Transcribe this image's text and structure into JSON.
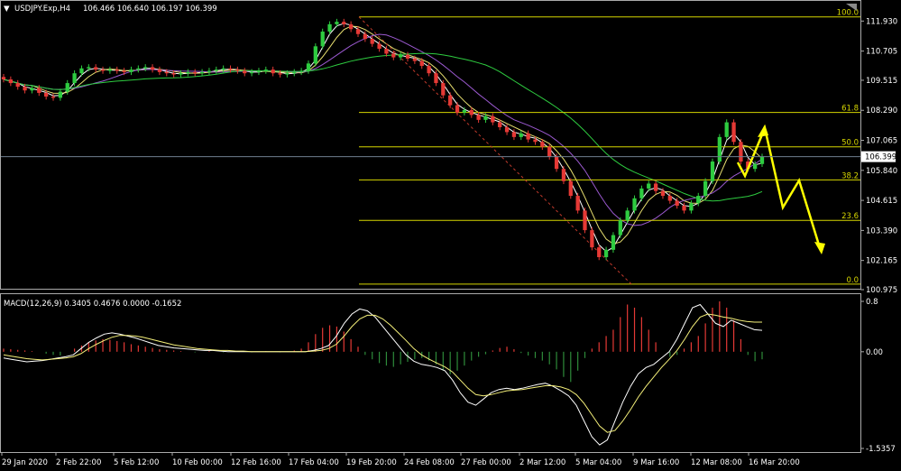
{
  "chart_data": [
    {
      "type": "candlestick",
      "title": "USDJPY.Exp,H4",
      "ohlc": "106.466 106.640 106.197 106.399",
      "current_price": "106.399",
      "y_ticks": [
        "111.930",
        "110.705",
        "109.515",
        "108.290",
        "107.065",
        "105.840",
        "104.615",
        "103.390",
        "102.165",
        "100.975"
      ],
      "ylim": [
        100.975,
        112.2
      ],
      "x_labels": [
        "29 Jan 2020",
        "2 Feb 22:00",
        "5 Feb 12:00",
        "10 Feb 00:00",
        "12 Feb 16:00",
        "17 Feb 04:00",
        "19 Feb 20:00",
        "24 Feb 08:00",
        "27 Feb 00:00",
        "2 Mar 12:00",
        "5 Mar 04:00",
        "9 Mar 16:00",
        "12 Mar 08:00",
        "16 Mar 20:00"
      ],
      "fibonacci": [
        {
          "label": "100.0",
          "value": 112.1
        },
        {
          "label": "61.8",
          "value": 108.2
        },
        {
          "label": "50.0",
          "value": 106.8
        },
        {
          "label": "38.2",
          "value": 105.45
        },
        {
          "label": "23.6",
          "value": 103.8
        },
        {
          "label": "0.0",
          "value": 101.2
        }
      ],
      "closes": [
        109.55,
        109.4,
        109.25,
        109.1,
        109.2,
        109.0,
        108.85,
        108.8,
        109.05,
        109.4,
        109.8,
        110.0,
        110.05,
        109.95,
        109.9,
        109.95,
        109.9,
        109.85,
        109.95,
        110.0,
        110.05,
        109.95,
        109.85,
        109.8,
        109.75,
        109.8,
        109.85,
        109.8,
        109.85,
        109.9,
        109.95,
        110.0,
        109.95,
        109.9,
        109.8,
        109.85,
        109.9,
        109.95,
        109.8,
        109.75,
        109.8,
        109.85,
        109.9,
        110.2,
        110.9,
        111.5,
        111.8,
        111.9,
        111.8,
        111.6,
        111.4,
        111.2,
        111.0,
        110.8,
        110.6,
        110.45,
        110.55,
        110.4,
        110.3,
        110.1,
        109.8,
        109.4,
        108.9,
        108.5,
        108.2,
        108.3,
        108.1,
        107.9,
        108.05,
        107.8,
        107.6,
        107.4,
        107.2,
        107.35,
        107.1,
        107.0,
        106.8,
        106.4,
        105.9,
        105.4,
        104.8,
        104.2,
        103.4,
        102.7,
        102.3,
        102.6,
        103.2,
        103.8,
        104.2,
        104.7,
        105.1,
        105.3,
        105.0,
        104.8,
        104.6,
        104.4,
        104.2,
        104.5,
        104.8,
        105.4,
        106.2,
        107.2,
        107.8,
        107.0,
        106.2,
        105.9,
        106.1,
        106.4
      ]
    },
    {
      "type": "bar-line",
      "title": "MACD(12,26,9) 0.3405 0.4676 0.0000 -0.1652",
      "y_ticks": [
        "0.8",
        "0.00",
        "-1.5357"
      ],
      "ylim": [
        -1.5357,
        0.8
      ],
      "histogram": [
        0.05,
        0.04,
        0.03,
        0.02,
        0.01,
        0.0,
        -0.03,
        -0.05,
        -0.06,
        0.0,
        0.05,
        0.1,
        0.15,
        0.18,
        0.2,
        0.19,
        0.17,
        0.15,
        0.12,
        0.1,
        0.08,
        0.06,
        0.04,
        0.03,
        0.02,
        0.01,
        0.0,
        -0.01,
        0.0,
        0.01,
        0.0,
        -0.01,
        0.0,
        0.01,
        0.0,
        -0.01,
        0.0,
        0.01,
        0.0,
        -0.01,
        0.0,
        0.02,
        0.05,
        0.15,
        0.28,
        0.38,
        0.42,
        0.4,
        0.32,
        0.2,
        0.08,
        -0.05,
        -0.12,
        -0.18,
        -0.22,
        -0.24,
        -0.2,
        -0.16,
        -0.12,
        -0.1,
        -0.14,
        -0.2,
        -0.3,
        -0.36,
        -0.3,
        -0.22,
        -0.14,
        -0.08,
        -0.04,
        0.02,
        0.06,
        0.08,
        0.04,
        -0.02,
        -0.06,
        -0.1,
        -0.14,
        -0.2,
        -0.28,
        -0.4,
        -0.48,
        -0.3,
        -0.1,
        0.05,
        0.15,
        0.25,
        0.35,
        0.55,
        0.75,
        0.7,
        0.55,
        0.35,
        0.15,
        0.0,
        -0.08,
        -0.05,
        0.05,
        0.15,
        0.25,
        0.45,
        0.7,
        0.8,
        0.7,
        0.5,
        0.2,
        -0.05,
        -0.15,
        -0.12
      ],
      "macd": [
        -0.1,
        -0.12,
        -0.14,
        -0.16,
        -0.15,
        -0.14,
        -0.12,
        -0.1,
        -0.08,
        -0.05,
        0.05,
        0.15,
        0.22,
        0.28,
        0.3,
        0.28,
        0.25,
        0.22,
        0.18,
        0.14,
        0.1,
        0.08,
        0.06,
        0.05,
        0.04,
        0.03,
        0.02,
        0.02,
        0.01,
        0.0,
        0.0,
        0.0,
        0.0,
        0.0,
        0.0,
        0.0,
        0.0,
        0.0,
        0.0,
        0.0,
        0.02,
        0.05,
        0.1,
        0.25,
        0.45,
        0.6,
        0.68,
        0.65,
        0.55,
        0.4,
        0.25,
        0.1,
        -0.05,
        -0.15,
        -0.2,
        -0.22,
        -0.25,
        -0.3,
        -0.45,
        -0.65,
        -0.8,
        -0.85,
        -0.75,
        -0.65,
        -0.6,
        -0.58,
        -0.6,
        -0.58,
        -0.55,
        -0.52,
        -0.5,
        -0.55,
        -0.62,
        -0.7,
        -0.85,
        -1.1,
        -1.35,
        -1.48,
        -1.4,
        -1.1,
        -0.8,
        -0.55,
        -0.35,
        -0.25,
        -0.2,
        -0.1,
        0.0,
        0.2,
        0.45,
        0.7,
        0.75,
        0.6,
        0.45,
        0.4,
        0.5,
        0.45,
        0.4,
        0.35,
        0.34
      ],
      "signal": [
        -0.05,
        -0.07,
        -0.09,
        -0.11,
        -0.12,
        -0.13,
        -0.12,
        -0.11,
        -0.1,
        -0.08,
        -0.03,
        0.05,
        0.12,
        0.18,
        0.23,
        0.26,
        0.26,
        0.25,
        0.23,
        0.2,
        0.17,
        0.14,
        0.11,
        0.09,
        0.07,
        0.05,
        0.04,
        0.03,
        0.02,
        0.02,
        0.01,
        0.01,
        0.0,
        0.0,
        0.0,
        0.0,
        0.0,
        0.0,
        0.0,
        0.0,
        0.01,
        0.02,
        0.05,
        0.12,
        0.25,
        0.4,
        0.52,
        0.58,
        0.58,
        0.52,
        0.42,
        0.3,
        0.18,
        0.05,
        -0.05,
        -0.12,
        -0.18,
        -0.24,
        -0.32,
        -0.45,
        -0.58,
        -0.68,
        -0.7,
        -0.68,
        -0.65,
        -0.62,
        -0.61,
        -0.6,
        -0.58,
        -0.56,
        -0.54,
        -0.54,
        -0.56,
        -0.6,
        -0.68,
        -0.82,
        -1.0,
        -1.18,
        -1.28,
        -1.25,
        -1.1,
        -0.92,
        -0.72,
        -0.55,
        -0.4,
        -0.25,
        -0.12,
        0.02,
        0.2,
        0.4,
        0.55,
        0.6,
        0.58,
        0.55,
        0.53,
        0.5,
        0.48,
        0.47,
        0.47
      ]
    }
  ]
}
